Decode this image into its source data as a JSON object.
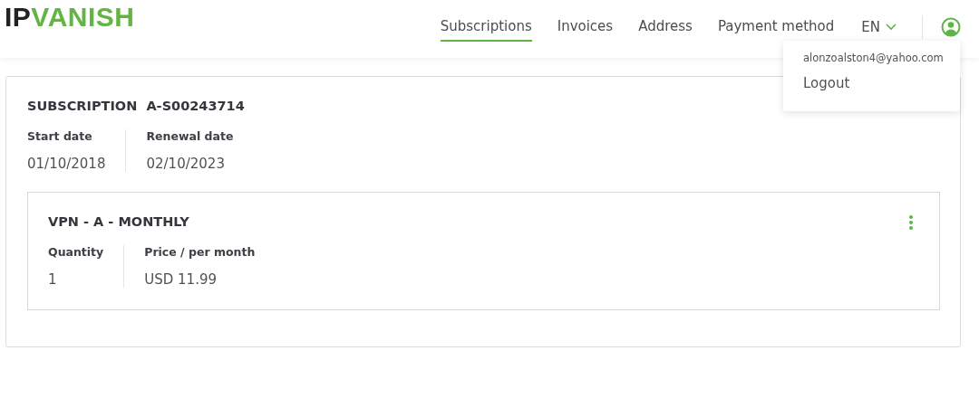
{
  "logo": {
    "dark_part": "IP",
    "green_part": "VANISH"
  },
  "nav": [
    {
      "label": "Subscriptions",
      "selected": true
    },
    {
      "label": "Invoices",
      "selected": false
    },
    {
      "label": "Address",
      "selected": false
    },
    {
      "label": "Payment method",
      "selected": false
    }
  ],
  "language": "EN",
  "user_menu": {
    "expanded": true,
    "email": "alonzoalston4@yahoo.com",
    "items": [
      "Logout"
    ]
  },
  "subscription": {
    "label": "SUBSCRIPTION",
    "id": "A-S00243714",
    "fields": [
      {
        "label": "Start date",
        "value": "01/10/2018"
      },
      {
        "label": "Renewal date",
        "value": "02/10/2023"
      }
    ],
    "product": {
      "title": "VPN - A - MONTHLY",
      "fields": [
        {
          "label": "Quantity",
          "value": "1"
        },
        {
          "label": "Price / per month",
          "value": "USD 11.99"
        }
      ]
    }
  }
}
